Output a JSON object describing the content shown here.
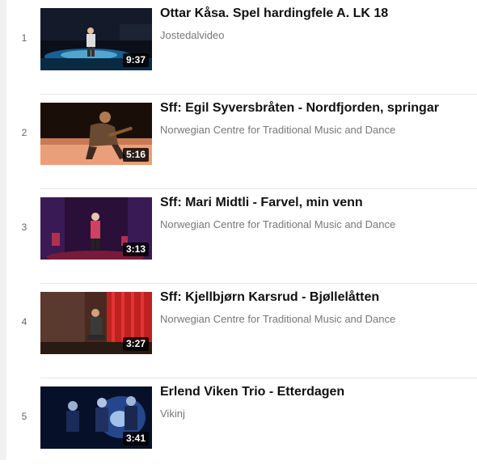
{
  "playlist": {
    "items": [
      {
        "index": "1",
        "title": "Ottar Kåsa. Spel hardingfele A. LK 18",
        "channel": "Jostedalvideo",
        "duration": "9:37",
        "thumbnail": "performer-on-stage-thumbnail"
      },
      {
        "index": "2",
        "title": "Sff: Egil Syversbråten - Nordfjorden, springar",
        "channel": "Norwegian Centre for Traditional Music and Dance",
        "duration": "5:16",
        "thumbnail": "seated-fiddler-thumbnail"
      },
      {
        "index": "3",
        "title": "Sff: Mari Midtli - Farvel, min venn",
        "channel": "Norwegian Centre for Traditional Music and Dance",
        "duration": "3:13",
        "thumbnail": "purple-stage-thumbnail"
      },
      {
        "index": "4",
        "title": "Sff: Kjellbjørn Karsrud - Bjøllelåtten",
        "channel": "Norwegian Centre for Traditional Music and Dance",
        "duration": "3:27",
        "thumbnail": "red-curtain-thumbnail"
      },
      {
        "index": "5",
        "title": "Erlend Viken Trio - Etterdagen",
        "channel": "Vikinj",
        "duration": "3:41",
        "thumbnail": "blue-light-trio-thumbnail"
      }
    ]
  }
}
